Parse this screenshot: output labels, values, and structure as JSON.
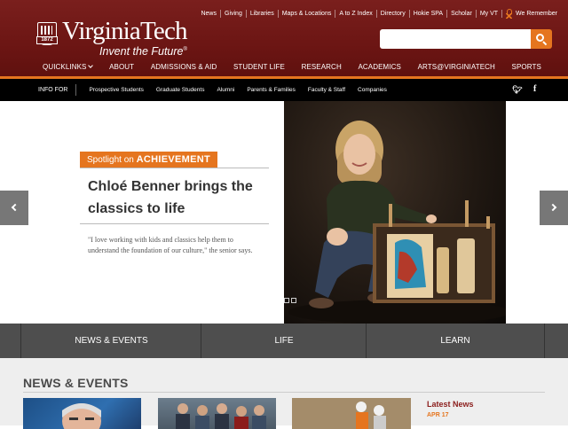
{
  "header": {
    "logo_word": "VirginiaTech",
    "logo_tagline": "Invent the Future",
    "logo_year": "1872",
    "utility_links": [
      "News",
      "Giving",
      "Libraries",
      "Maps & Locations",
      "A to Z Index",
      "Directory",
      "Hokie SPA",
      "Scholar",
      "My VT"
    ],
    "remember_label": "We Remember",
    "search": {
      "value": "",
      "placeholder": ""
    }
  },
  "main_nav": [
    "QUICKLINKS",
    "ABOUT",
    "ADMISSIONS & AID",
    "STUDENT LIFE",
    "RESEARCH",
    "ACADEMICS",
    "ARTS@VIRGINIATECH",
    "SPORTS"
  ],
  "info_bar": {
    "label": "INFO FOR",
    "links": [
      "Prospective Students",
      "Graduate Students",
      "Alumni",
      "Parents & Families",
      "Faculty & Staff",
      "Companies"
    ]
  },
  "hero": {
    "spotlight_prefix": "Spotlight on",
    "spotlight_word": "ACHIEVEMENT",
    "title": "Chloé Benner brings the classics to life",
    "quote": "\"I love working with kids and classics help them to understand the foundation of our culture,\" the senior says."
  },
  "section_tabs": [
    "NEWS & EVENTS",
    "LIFE",
    "LEARN"
  ],
  "news": {
    "heading": "NEWS & EVENTS",
    "latest_heading": "Latest News",
    "latest_date": "APR 17"
  },
  "colors": {
    "maroon": "#6b1513",
    "orange": "#e5751f",
    "section_bar": "#4e4e4e"
  }
}
